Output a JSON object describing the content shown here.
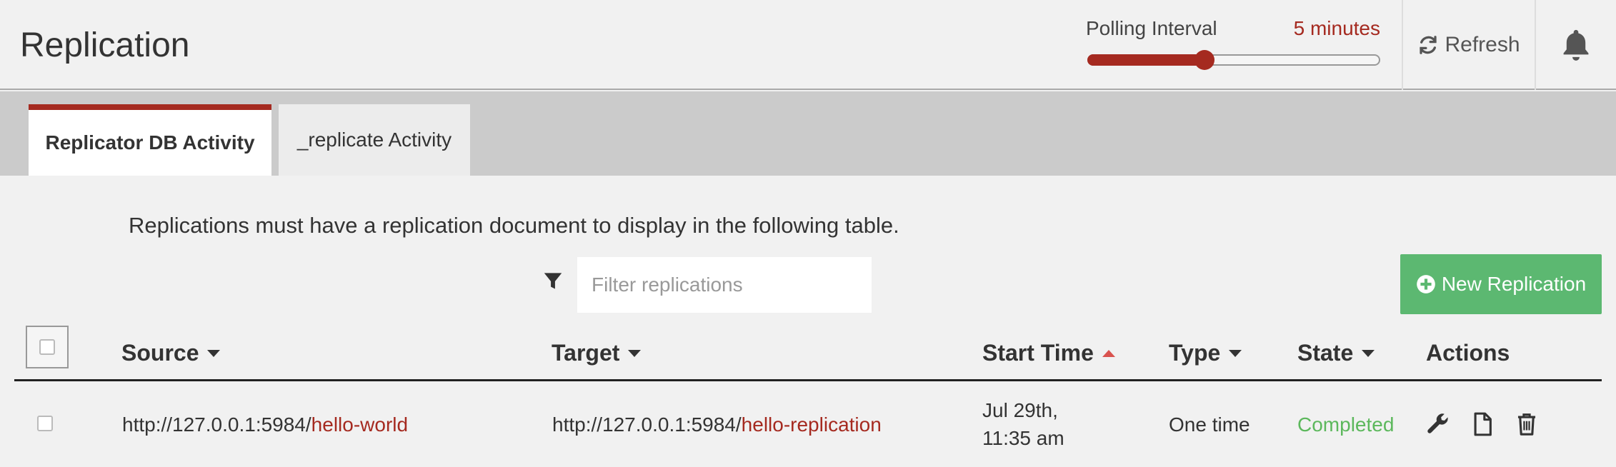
{
  "header": {
    "title": "Replication",
    "polling": {
      "label": "Polling Interval",
      "value": "5 minutes",
      "level_percent": 40
    },
    "refresh_label": "Refresh"
  },
  "tabs": [
    {
      "label": "Replicator DB Activity",
      "active": true
    },
    {
      "label": "_replicate Activity",
      "active": false
    }
  ],
  "notice": "Replications must have a replication document to display in the following table.",
  "filter": {
    "placeholder": "Filter replications",
    "value": ""
  },
  "new_button_label": "New Replication",
  "table": {
    "columns": [
      "Source",
      "Target",
      "Start Time",
      "Type",
      "State",
      "Actions"
    ],
    "sort": {
      "column": "Start Time",
      "direction": "asc"
    },
    "rows": [
      {
        "source_host": "http://127.0.0.1:5984/",
        "source_db": "hello-world",
        "target_host": "http://127.0.0.1:5984/",
        "target_db": "hello-replication",
        "start_time": "Jul 29th, 11:35 am",
        "type": "One time",
        "state": "Completed",
        "actions": [
          "wrench-icon",
          "document-icon",
          "trash-icon"
        ]
      }
    ]
  },
  "colors": {
    "accent": "#a52a20",
    "success": "#5cb871",
    "state_completed": "#5cb85c"
  }
}
